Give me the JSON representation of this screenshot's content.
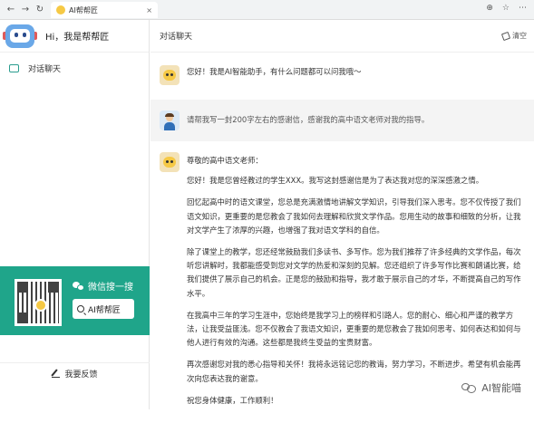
{
  "browser": {
    "tab_title": "AI帮帮匠",
    "tab_close": "×",
    "nav": {
      "back": "←",
      "forward": "→",
      "reload": "↻"
    },
    "controls": [
      "⊕",
      "☆",
      "⋯"
    ]
  },
  "sidebar": {
    "greeting": "Hi，我是帮帮匠",
    "nav_items": [
      {
        "label": "对话聊天",
        "icon": "chat-icon"
      }
    ],
    "promo": {
      "wechat_label": "微信搜一搜",
      "search_value": "AI帮帮匠",
      "background_color": "#1fa58a"
    },
    "feedback_label": "我要反馈"
  },
  "main": {
    "header_title": "对话聊天",
    "clear_label": "清空",
    "messages": [
      {
        "role": "bot",
        "text": "您好！我是AI智能助手，有什么问题都可以问我哦～"
      },
      {
        "role": "user",
        "text": "请帮我写一封200字左右的感谢信，感谢我的高中语文老师对我的指导。"
      }
    ],
    "letter": {
      "salutation": "尊敬的高中语文老师：",
      "paragraphs": [
        "您好！我是您曾经教过的学生XXX。我写这封感谢信是为了表达我对您的深深感激之情。",
        "回忆起高中时的语文课堂，您总是充满激情地讲解文学知识，引导我们深入思考。您不仅传授了我们语文知识，更重要的是您教会了我如何去理解和欣赏文学作品。您用生动的故事和细致的分析，让我对文学产生了浓厚的兴趣，也增强了我对语文学科的自信。",
        "除了课堂上的教学，您还经常鼓励我们多读书、多写作。您为我们推荐了许多经典的文学作品，每次听您讲解时，我都能感受到您对文学的热爱和深刻的见解。您还组织了许多写作比赛和朗诵比赛，给我们提供了展示自己的机会。正是您的鼓励和指导，我才敢于展示自己的才华，不断提高自己的写作水平。",
        "在我高中三年的学习生涯中，您始终是我学习上的榜样和引路人。您的耐心、细心和严谨的教学方法，让我受益匪浅。您不仅教会了我语文知识，更重要的是您教会了我如何思考、如何表达和如何与他人进行有效的沟通。这些都是我终生受益的宝贵财富。",
        "再次感谢您对我的悉心指导和关怀！我将永远铭记您的教诲，努力学习，不断进步。希望有机会能再次向您表达我的谢意。",
        "祝您身体健康，工作顺利！"
      ]
    },
    "watermark": "AI智能喵"
  }
}
